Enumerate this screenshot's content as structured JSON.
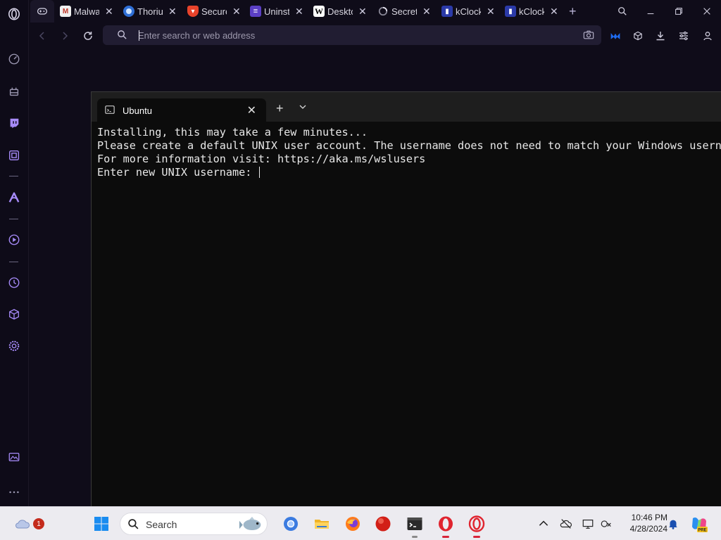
{
  "browser": {
    "tabs": [
      {
        "title": "Malwa",
        "favicon": "malwarebytes-favicon"
      },
      {
        "title": "Thoriu",
        "favicon": "thorium-favicon"
      },
      {
        "title": "Secure",
        "favicon": "brave-favicon"
      },
      {
        "title": "Uninst",
        "favicon": "list-favicon"
      },
      {
        "title": "Deskto",
        "favicon": "wikipedia-favicon"
      },
      {
        "title": "Secret",
        "favicon": "spinner-favicon"
      },
      {
        "title": "kClock",
        "favicon": "kclock-favicon"
      },
      {
        "title": "kClock",
        "favicon": "kclock-favicon"
      }
    ],
    "address_placeholder": "Enter search or web address"
  },
  "terminal": {
    "tab_title": "Ubuntu",
    "lines": [
      "Installing, this may take a few minutes...",
      "Please create a default UNIX user account. The username does not need to match your Windows usernar",
      "For more information visit: https://aka.ms/wslusers",
      "Enter new UNIX username: "
    ]
  },
  "taskbar": {
    "search_label": "Search",
    "weather_badge": "1",
    "time": "10:46 PM",
    "date": "4/28/2024"
  },
  "colors": {
    "opera_accent": "#a78bfa",
    "opera_red": "#e0242f",
    "terminal_bg": "#0c0c0c",
    "browser_bg": "#0f0c19"
  }
}
